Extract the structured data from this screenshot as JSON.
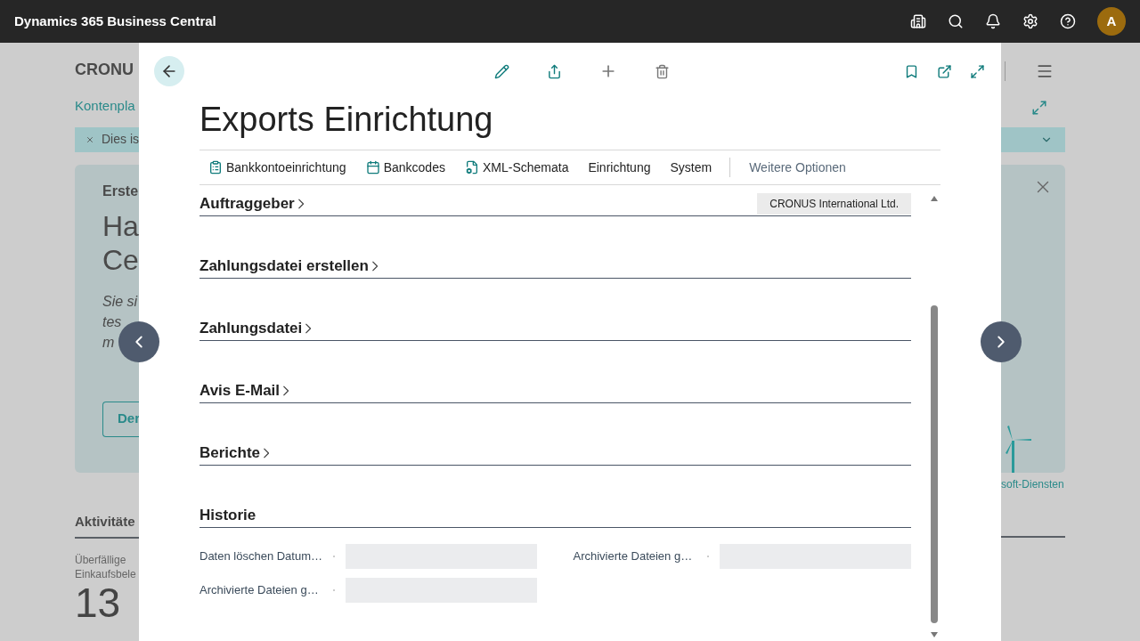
{
  "app_bar": {
    "title": "Dynamics 365 Business Central",
    "avatar": "A"
  },
  "background_page": {
    "company": "CRONU",
    "breadcrumb": "Kontenpla",
    "banner": "Dies is",
    "card_kicker": "Erste",
    "card_heading": [
      "Ha",
      "Ce"
    ],
    "card_text": [
      "Sie si",
      "tes",
      "m"
    ],
    "card_button": "Der",
    "card_link": "soft-Diensten",
    "activities_title": "Aktivitäte",
    "tile_label": [
      "Überfällige",
      "Einkaufsbele"
    ],
    "tile_value": "13"
  },
  "dialog": {
    "title": "Exports Einrichtung",
    "actions": [
      {
        "kind": "icon_action",
        "label": "Bankkontoeinrichtung"
      },
      {
        "kind": "icon_action",
        "label": "Bankcodes"
      },
      {
        "kind": "icon_action",
        "label": "XML-Schemata"
      },
      {
        "kind": "action",
        "label": "Einrichtung"
      },
      {
        "kind": "action",
        "label": "System"
      },
      {
        "kind": "more",
        "label": "Weitere Optionen"
      }
    ],
    "sections": [
      {
        "title": "Auftraggeber",
        "expanded": false,
        "summary": "CRONUS International Ltd."
      },
      {
        "title": "Zahlungsdatei erstellen",
        "expanded": false
      },
      {
        "title": "Zahlungsdatei",
        "expanded": false
      },
      {
        "title": "Avis E-Mail",
        "expanded": false
      },
      {
        "title": "Berichte",
        "expanded": false
      },
      {
        "title": "Historie",
        "expanded": true,
        "columns": [
          {
            "fields": [
              {
                "label": "Daten löschen Datum…"
              },
              {
                "label": "Archivierte Dateien g…"
              }
            ]
          },
          {
            "fields": [
              {
                "label": "Archivierte Dateien g…"
              }
            ]
          }
        ]
      }
    ]
  }
}
